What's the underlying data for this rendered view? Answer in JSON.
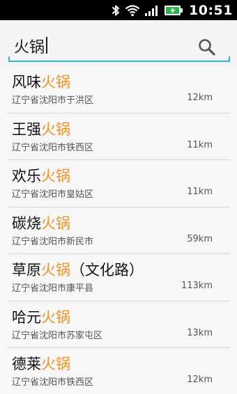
{
  "status_bar": {
    "time": "10:51",
    "icons": [
      "bluetooth-icon",
      "wifi-icon",
      "signal-icon",
      "battery-charging-icon"
    ]
  },
  "search": {
    "value": "火锅",
    "icon": "search-icon",
    "accent_color": "#35aee0"
  },
  "results": [
    {
      "prefix": "风味",
      "keyword": "火锅",
      "suffix": "",
      "address": "辽宁省沈阳市于洪区",
      "distance": "12km"
    },
    {
      "prefix": "王强",
      "keyword": "火锅",
      "suffix": "",
      "address": "辽宁省沈阳市铁西区",
      "distance": "11km"
    },
    {
      "prefix": "欢乐",
      "keyword": "火锅",
      "suffix": "",
      "address": "辽宁省沈阳市皇姑区",
      "distance": "11km"
    },
    {
      "prefix": "碳烧",
      "keyword": "火锅",
      "suffix": "",
      "address": "辽宁省沈阳市新民市",
      "distance": "59km"
    },
    {
      "prefix": "草原",
      "keyword": "火锅",
      "suffix": "（文化路）",
      "address": "辽宁省沈阳市康平县",
      "distance": "113km"
    },
    {
      "prefix": "哈元",
      "keyword": "火锅",
      "suffix": "",
      "address": "辽宁省沈阳市苏家屯区",
      "distance": "13km"
    },
    {
      "prefix": "德莱",
      "keyword": "火锅",
      "suffix": "",
      "address": "辽宁省沈阳市铁西区",
      "distance": "12km"
    }
  ],
  "highlight_color": "#f4901e"
}
